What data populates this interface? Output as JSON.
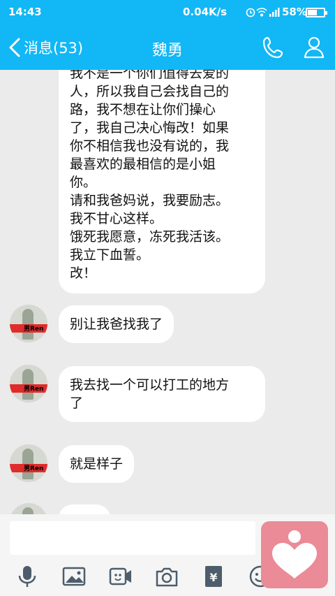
{
  "status_bar": {
    "time": "14:43",
    "network_speed": "0.04K/s",
    "battery_percent": "58%",
    "battery_level": 0.58
  },
  "nav": {
    "back_label": "消息(53)",
    "title": "魏勇"
  },
  "messages": [
    {
      "text": "我不是一个你们值得去爱的\n人，所以我自己会找自己的\n路，我不想在让你们操心\n了，我自己决心悔改！如果\n你不相信我也没有说的，我\n最喜欢的最相信的是小姐\n你。\n请和我爸妈说，我要励志。\n我不甘心这样。\n饿死我愿意，冻死我活该。\n我立下血誓。\n改！"
    },
    {
      "text": "别让我爸找我了"
    },
    {
      "text": "我去找一个可以打工的地方\n了"
    },
    {
      "text": "就是样子"
    },
    {
      "text": ""
    }
  ],
  "avatar_label": "男Ren",
  "colors": {
    "accent": "#12b7f5",
    "chat_background": "#ebebeb",
    "sticker_button": "#ea8b97"
  },
  "toolbar_icons": [
    "microphone-icon",
    "image-icon",
    "video-icon",
    "camera-icon",
    "red-packet-icon",
    "emoji-icon"
  ]
}
